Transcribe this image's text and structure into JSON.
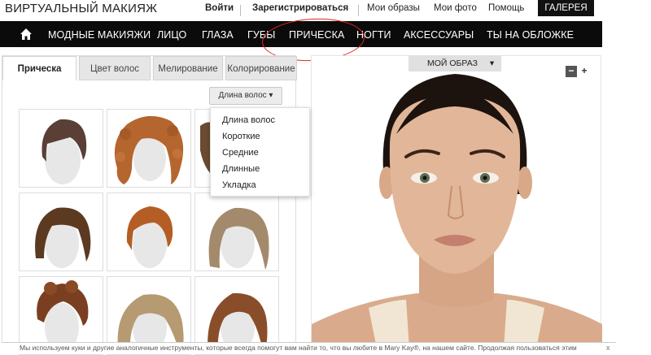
{
  "header": {
    "brand": "ВИРТУАЛЬНЫЙ МАКИЯЖ",
    "login": "Войти",
    "register": "Зарегистрироваться",
    "my_looks": "Мои образы",
    "my_photo": "Мои фото",
    "help": "Помощь",
    "gallery": "ГАЛЕРЕЯ"
  },
  "nav": {
    "items": [
      "МОДНЫЕ МАКИЯЖИ",
      "ЛИЦО",
      "ГЛАЗА",
      "ГУБЫ",
      "ПРИЧЕСКА",
      "НОГТИ",
      "АКСЕССУАРЫ",
      "ТЫ НА ОБЛОЖКЕ"
    ]
  },
  "tabs": [
    "Прическа",
    "Цвет волос",
    "Мелирование",
    "Колорирование"
  ],
  "filter": {
    "button_label": "Длина волос",
    "options": [
      "Длина волос",
      "Короткие",
      "Средние",
      "Длинные",
      "Укладка"
    ]
  },
  "preview": {
    "selector_label": "МОЙ ОБРАЗ",
    "zoom_out": "−",
    "zoom_in": "+"
  },
  "cookie_notice": {
    "text": "Мы используем куки и другие аналогичные инструменты, которые всегда помогут вам найти то, что вы любите в Mary Kay®, на нашем сайте. Продолжая пользоваться этим",
    "close": "x"
  },
  "colors": {
    "nav_bg": "#0b0b0b",
    "highlight_circle": "#e32626",
    "accent_gallery": "#111111"
  }
}
